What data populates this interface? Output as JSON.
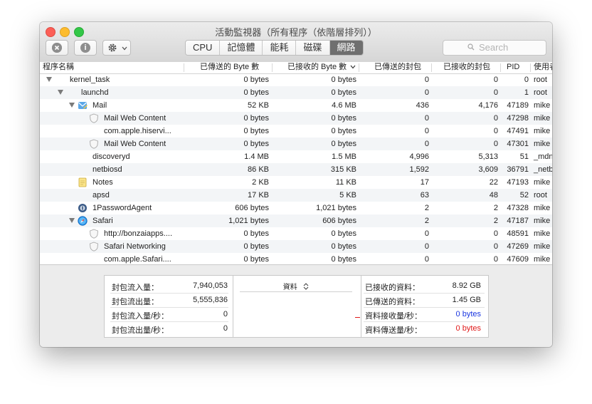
{
  "window": {
    "title": "活動監視器（所有程序（依階層排列））"
  },
  "toolbar": {
    "stop_icon": "close-circle-icon",
    "info_icon": "info-icon",
    "info_glyph": "i",
    "gear_icon": "gear-icon",
    "tabs": [
      {
        "label": "CPU"
      },
      {
        "label": "記憶體"
      },
      {
        "label": "能耗"
      },
      {
        "label": "磁碟"
      },
      {
        "label": "網路"
      }
    ],
    "active_tab": "網路",
    "search_placeholder": "Search"
  },
  "table": {
    "columns": {
      "name": "程序名稱",
      "bytes_sent": "已傳送的 Byte 數",
      "bytes_recv": "已接收的 Byte 數",
      "packets_sent": "已傳送的封包",
      "packets_recv": "已接收的封包",
      "pid": "PID",
      "user": "使用者"
    },
    "rows": [
      {
        "name": "kernel_task",
        "sent": "0 bytes",
        "recv": "0 bytes",
        "psent": "0",
        "precv": "0",
        "pid": "0",
        "user": "root"
      },
      {
        "name": "launchd",
        "sent": "0 bytes",
        "recv": "0 bytes",
        "psent": "0",
        "precv": "0",
        "pid": "1",
        "user": "root"
      },
      {
        "name": "Mail",
        "sent": "52 KB",
        "recv": "4.6 MB",
        "psent": "436",
        "precv": "4,176",
        "pid": "47189",
        "user": "mike"
      },
      {
        "name": "Mail Web Content",
        "sent": "0 bytes",
        "recv": "0 bytes",
        "psent": "0",
        "precv": "0",
        "pid": "47298",
        "user": "mike"
      },
      {
        "name": "com.apple.hiservi...",
        "sent": "0 bytes",
        "recv": "0 bytes",
        "psent": "0",
        "precv": "0",
        "pid": "47491",
        "user": "mike"
      },
      {
        "name": "Mail Web Content",
        "sent": "0 bytes",
        "recv": "0 bytes",
        "psent": "0",
        "precv": "0",
        "pid": "47301",
        "user": "mike"
      },
      {
        "name": "discoveryd",
        "sent": "1.4 MB",
        "recv": "1.5 MB",
        "psent": "4,996",
        "precv": "5,313",
        "pid": "51",
        "user": "_mdn"
      },
      {
        "name": "netbiosd",
        "sent": "86 KB",
        "recv": "315 KB",
        "psent": "1,592",
        "precv": "3,609",
        "pid": "36791",
        "user": "_netb"
      },
      {
        "name": "Notes",
        "sent": "2 KB",
        "recv": "11 KB",
        "psent": "17",
        "precv": "22",
        "pid": "47193",
        "user": "mike"
      },
      {
        "name": "apsd",
        "sent": "17 KB",
        "recv": "5 KB",
        "psent": "63",
        "precv": "48",
        "pid": "52",
        "user": "root"
      },
      {
        "name": "1PasswordAgent",
        "sent": "606 bytes",
        "recv": "1,021 bytes",
        "psent": "2",
        "precv": "2",
        "pid": "47328",
        "user": "mike"
      },
      {
        "name": "Safari",
        "sent": "1,021 bytes",
        "recv": "606 bytes",
        "psent": "2",
        "precv": "2",
        "pid": "47187",
        "user": "mike"
      },
      {
        "name": "http://bonzaiapps....",
        "sent": "0 bytes",
        "recv": "0 bytes",
        "psent": "0",
        "precv": "0",
        "pid": "48591",
        "user": "mike"
      },
      {
        "name": "Safari Networking",
        "sent": "0 bytes",
        "recv": "0 bytes",
        "psent": "0",
        "precv": "0",
        "pid": "47269",
        "user": "mike"
      },
      {
        "name": "com.apple.Safari....",
        "sent": "0 bytes",
        "recv": "0 bytes",
        "psent": "0",
        "precv": "0",
        "pid": "47609",
        "user": "mike"
      }
    ]
  },
  "summary": {
    "packets_in_label": "封包流入量：",
    "packets_in": "7,940,053",
    "packets_out_label": "封包流出量：",
    "packets_out": "5,555,836",
    "packets_in_sec_label": "封包流入量/秒：",
    "packets_in_sec": "0",
    "packets_out_sec_label": "封包流出量/秒：",
    "packets_out_sec": "0",
    "graph_label": "資料",
    "data_recv_label": "已接收的資料：",
    "data_recv": "8.92 GB",
    "data_sent_label": "已傳送的資料：",
    "data_sent": "1.45 GB",
    "data_recv_sec_label": "資料接收量/秒：",
    "data_recv_sec": "0 bytes",
    "data_sent_sec_label": "資料傳送量/秒：",
    "data_sent_sec": "0 bytes",
    "recv_color": "#1a36e0",
    "sent_color": "#e01a1a"
  }
}
